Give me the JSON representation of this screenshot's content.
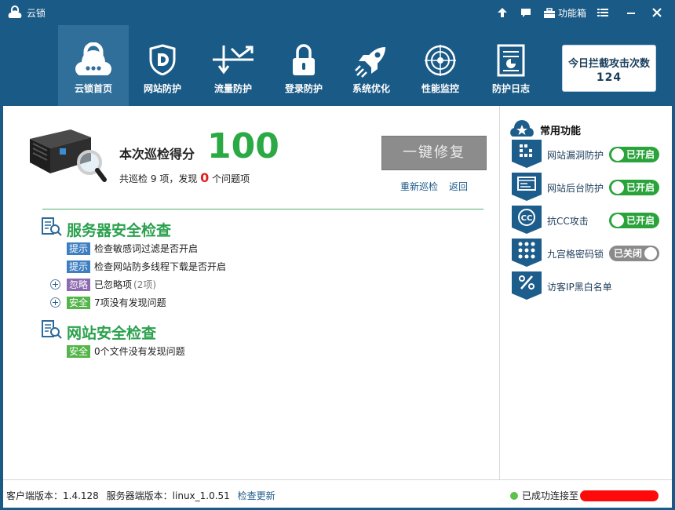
{
  "app": {
    "title": "云锁"
  },
  "titlebar": {
    "toolbox_label": "功能箱"
  },
  "nav": {
    "items": [
      {
        "id": "home",
        "label": "云锁首页",
        "icon": "cloud-lock-icon",
        "active": true
      },
      {
        "id": "site",
        "label": "网站防护",
        "icon": "shield-d-icon",
        "active": false
      },
      {
        "id": "traffic",
        "label": "流量防护",
        "icon": "traffic-icon",
        "active": false
      },
      {
        "id": "login",
        "label": "登录防护",
        "icon": "padlock-icon",
        "active": false
      },
      {
        "id": "optimize",
        "label": "系统优化",
        "icon": "rocket-icon",
        "active": false
      },
      {
        "id": "monitor",
        "label": "性能监控",
        "icon": "radar-icon",
        "active": false
      },
      {
        "id": "log",
        "label": "防护日志",
        "icon": "report-icon",
        "active": false
      }
    ],
    "attack": {
      "label": "今日拦截攻击次数",
      "count": "124"
    }
  },
  "scan": {
    "score_label": "本次巡检得分",
    "score": "100",
    "summary_prefix": "共巡检",
    "items_count": "9",
    "summary_mid": "项，发现",
    "problem_count": "0",
    "summary_suffix": "个问题项",
    "fix_button": "一键修复",
    "rescan_link": "重新巡检",
    "back_link": "返回"
  },
  "server_check": {
    "title": "服务器安全检查",
    "rows": [
      {
        "tag": "提示",
        "text": "检查敏感词过滤是否开启",
        "extra": ""
      },
      {
        "tag": "提示",
        "text": "检查网站防多线程下载是否开启",
        "extra": ""
      },
      {
        "tag": "忽略",
        "text": "已忽略项",
        "extra": "(2项)"
      },
      {
        "tag": "安全",
        "text": "7项没有发现问题",
        "extra": ""
      }
    ]
  },
  "site_check": {
    "title": "网站安全检查",
    "rows": [
      {
        "tag": "安全",
        "text": "0个文件没有发现问题"
      }
    ]
  },
  "common": {
    "title": "常用功能",
    "items": [
      {
        "label": "网站漏洞防护",
        "icon": "vuln-icon",
        "toggle": "已开启",
        "on": true
      },
      {
        "label": "网站后台防护",
        "icon": "admin-panel-icon",
        "toggle": "已开启",
        "on": true
      },
      {
        "label": "抗CC攻击",
        "icon": "cc-icon",
        "toggle": "已开启",
        "on": true
      },
      {
        "label": "九宫格密码锁",
        "icon": "grid-lock-icon",
        "toggle": "已关闭",
        "on": false
      },
      {
        "label": "访客IP黑白名单",
        "icon": "ip-list-icon",
        "toggle": "",
        "on": null
      }
    ]
  },
  "footer": {
    "client_label": "客户端版本：",
    "client_version": "1.4.128",
    "server_label": "服务器端版本：",
    "server_version": "linux_1.0.51",
    "update_link": "检查更新",
    "status_text": "已成功连接至"
  },
  "colors": {
    "chrome": "#1a5a86",
    "nav_active": "#2f6f9a",
    "score_green": "#2aa944",
    "toggle_on": "#2aa33b",
    "toggle_off": "#8a8a8a",
    "alert_red": "#e02020"
  }
}
